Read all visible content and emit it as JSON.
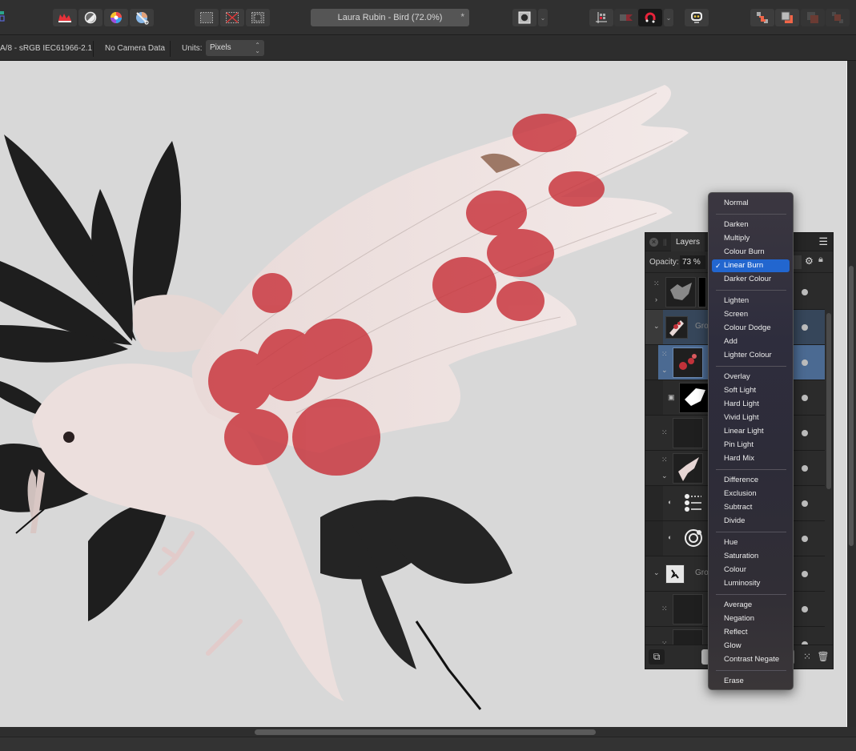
{
  "toolbar": {
    "document_title": "Laura Rubin - Bird (72.0%)",
    "modified_indicator": "*",
    "persona_icon": "persona-icon",
    "left_tools": [
      "levels-adjustment-icon",
      "tone-adjustment-icon",
      "colour-wheel-icon",
      "gradient-tool-icon"
    ],
    "selection_tools": [
      "select-all-icon",
      "deselect-icon",
      "invert-selection-icon"
    ],
    "mask_tool": "quick-mask-icon",
    "snapping_tools": [
      "grid-snapping-icon",
      "force-pixel-alignment-icon",
      "snapping-magnet-icon"
    ],
    "assistant_tool": "assistant-icon",
    "arrange_tools": [
      "move-to-back-icon",
      "move-backward-icon",
      "move-forward-icon",
      "move-to-front-icon"
    ]
  },
  "context_bar": {
    "colour_profile": "A/8 - sRGB IEC61966-2.1",
    "camera_data": "No Camera Data",
    "units_label": "Units:",
    "units_value": "Pixels"
  },
  "layers_panel": {
    "tab_label": "Layers",
    "opacity_label": "Opacity:",
    "opacity_value": "73 %",
    "rows": [
      {
        "type": "pixel",
        "name": "",
        "expand": ">",
        "selected": false
      },
      {
        "type": "group",
        "name": "Gro",
        "expand": "v",
        "selected": "group"
      },
      {
        "type": "pixel",
        "name": "",
        "expand": "v",
        "selected": true,
        "locked": true
      },
      {
        "type": "mask",
        "name": "",
        "selected": false
      },
      {
        "type": "pixel",
        "name": "",
        "selected": false
      },
      {
        "type": "pixel",
        "name": "",
        "expand": "v",
        "selected": false
      },
      {
        "type": "adjustment",
        "name": "",
        "selected": false
      },
      {
        "type": "adjustment",
        "name": "",
        "selected": false
      },
      {
        "type": "group",
        "name": "Gro",
        "expand": "v",
        "selected": false
      },
      {
        "type": "pixel",
        "name": "",
        "selected": false
      },
      {
        "type": "pixel",
        "name": "",
        "selected": false
      }
    ]
  },
  "blend_mode_menu": {
    "selected": "Linear Burn",
    "groups": [
      [
        "Normal"
      ],
      [
        "Darken",
        "Multiply",
        "Colour Burn",
        "Linear Burn",
        "Darker Colour"
      ],
      [
        "Lighten",
        "Screen",
        "Colour Dodge",
        "Add",
        "Lighter Colour"
      ],
      [
        "Overlay",
        "Soft Light",
        "Hard Light",
        "Vivid Light",
        "Linear Light",
        "Pin Light",
        "Hard Mix"
      ],
      [
        "Difference",
        "Exclusion",
        "Subtract",
        "Divide"
      ],
      [
        "Hue",
        "Saturation",
        "Colour",
        "Luminosity"
      ],
      [
        "Average",
        "Negation",
        "Reflect",
        "Glow",
        "Contrast Negate"
      ],
      [
        "Erase"
      ]
    ]
  },
  "colors": {
    "accent_selected": "#2266cf",
    "layer_selected": "#4b6a92",
    "canvas_background": "#d8d8d8",
    "magnet_red": "#e8233a"
  }
}
